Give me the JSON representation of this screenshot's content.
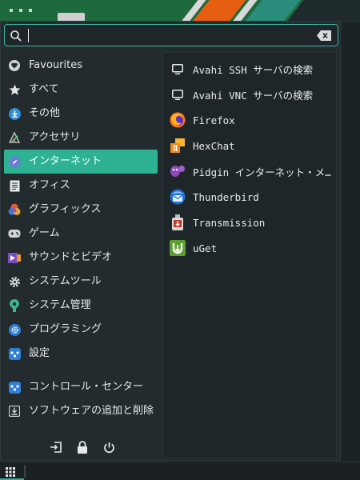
{
  "search": {
    "value": "",
    "placeholder": ""
  },
  "categories": [
    {
      "label": "Favourites",
      "icon": "heart-icon",
      "active": false
    },
    {
      "label": "すべて",
      "icon": "star-icon",
      "active": false
    },
    {
      "label": "その他",
      "icon": "download-icon",
      "active": false
    },
    {
      "label": "アクセサリ",
      "icon": "accessories-icon",
      "active": false
    },
    {
      "label": "インターネット",
      "icon": "compass-icon",
      "active": true
    },
    {
      "label": "オフィス",
      "icon": "document-icon",
      "active": false
    },
    {
      "label": "グラフィックス",
      "icon": "graphics-icon",
      "active": false
    },
    {
      "label": "ゲーム",
      "icon": "gamepad-icon",
      "active": false
    },
    {
      "label": "サウンドとビデオ",
      "icon": "multimedia-icon",
      "active": false
    },
    {
      "label": "システムツール",
      "icon": "system-tools-icon",
      "active": false
    },
    {
      "label": "システム管理",
      "icon": "system-admin-icon",
      "active": false
    },
    {
      "label": "プログラミング",
      "icon": "programming-icon",
      "active": false
    },
    {
      "label": "設定",
      "icon": "settings-icon",
      "active": false
    }
  ],
  "system_items": [
    {
      "label": "コントロール・センター",
      "icon": "control-center-icon"
    },
    {
      "label": "ソフトウェアの追加と削除",
      "icon": "software-install-icon"
    }
  ],
  "actions": [
    {
      "icon": "logout-icon"
    },
    {
      "icon": "lock-icon"
    },
    {
      "icon": "power-icon"
    }
  ],
  "apps": [
    {
      "label": "Avahi SSH サーバの検索",
      "icon": "monitor-icon"
    },
    {
      "label": "Avahi VNC サーバの検索",
      "icon": "monitor-icon"
    },
    {
      "label": "Firefox",
      "icon": "firefox-icon"
    },
    {
      "label": "HexChat",
      "icon": "hexchat-icon"
    },
    {
      "label": "Pidgin インターネット・メッセンジャー",
      "icon": "pidgin-icon"
    },
    {
      "label": "Thunderbird",
      "icon": "thunderbird-icon"
    },
    {
      "label": "Transmission",
      "icon": "transmission-icon"
    },
    {
      "label": "uGet",
      "icon": "uget-icon"
    }
  ],
  "colors": {
    "accent": "#2fb294",
    "panel": "#232b2e",
    "list_bg": "#1f2629"
  }
}
